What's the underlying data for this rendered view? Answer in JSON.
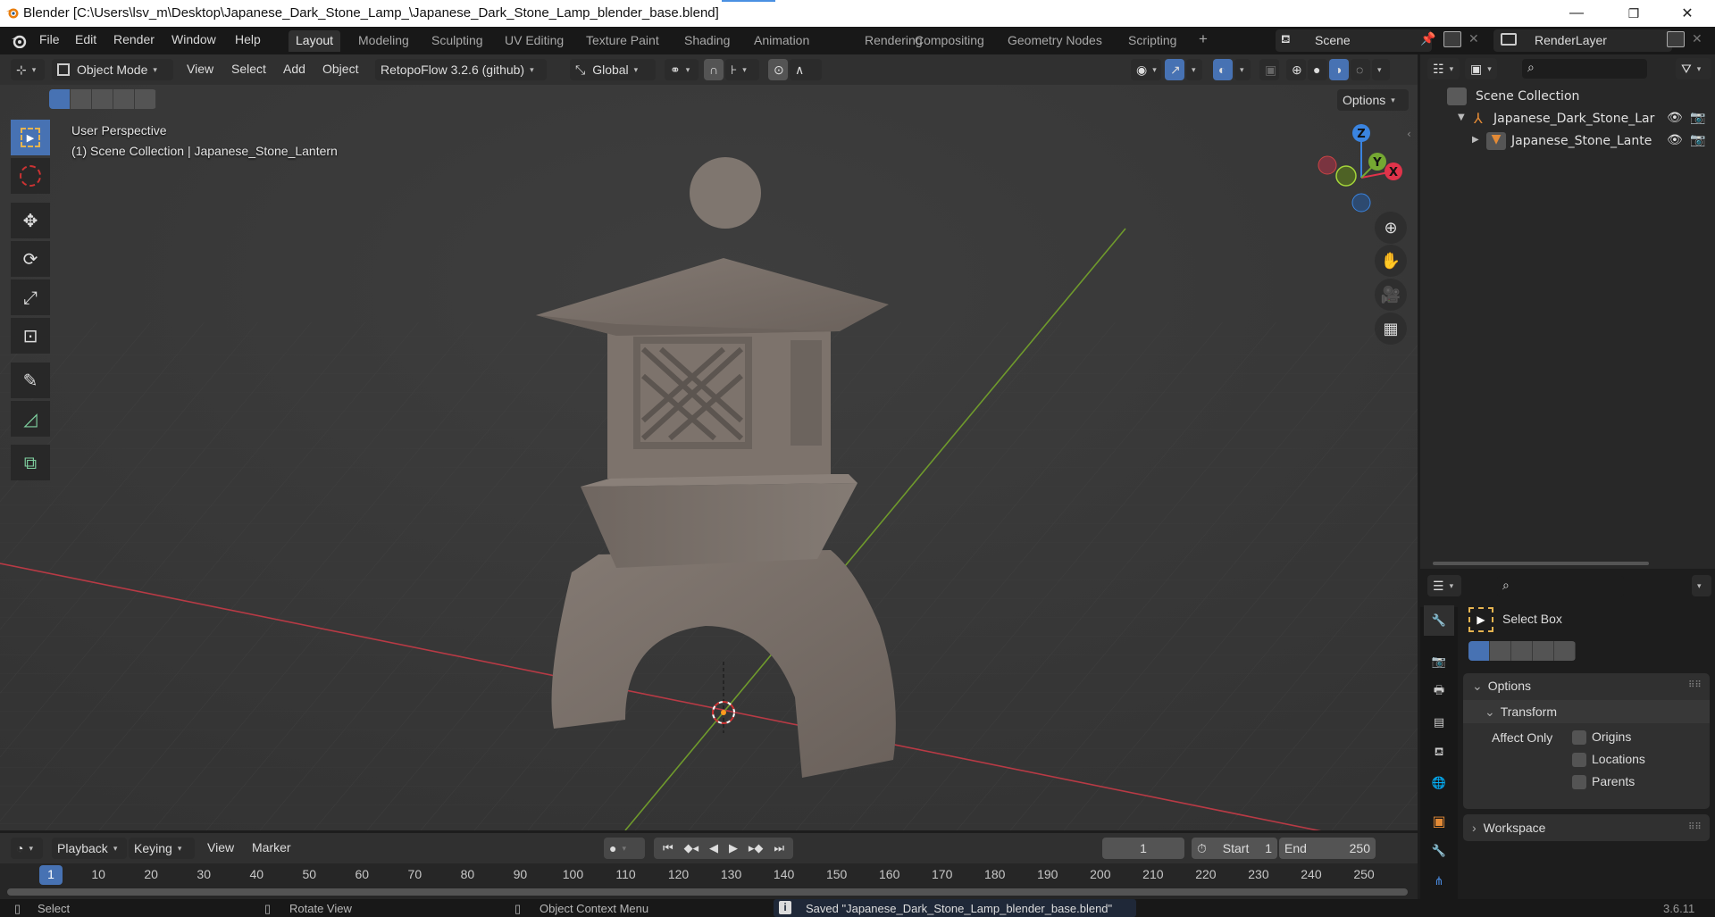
{
  "window": {
    "title": "Blender [C:\\Users\\lsv_m\\Desktop\\Japanese_Dark_Stone_Lamp_\\Japanese_Dark_Stone_Lamp_blender_base.blend]",
    "controls": {
      "minimize": "—",
      "maximize": "❐",
      "close": "✕"
    }
  },
  "menu": [
    "File",
    "Edit",
    "Render",
    "Window",
    "Help"
  ],
  "workspaces": [
    "Layout",
    "Modeling",
    "Sculpting",
    "UV Editing",
    "Texture Paint",
    "Shading",
    "Animation",
    "Rendering",
    "Compositing",
    "Geometry Nodes",
    "Scripting"
  ],
  "active_workspace": "Layout",
  "add_workspace": "+",
  "scene": {
    "name": "Scene",
    "view_layer": "RenderLayer"
  },
  "viewport_header": {
    "mode": "Object Mode",
    "menus": [
      "View",
      "Select",
      "Add",
      "Object"
    ],
    "addon": "RetopoFlow 3.2.6 (github)",
    "transform_orientation": "Global",
    "options": "Options"
  },
  "viewport": {
    "perspective": "User Perspective",
    "collection_info": "(1) Scene Collection | Japanese_Stone_Lantern",
    "gizmo_axes": {
      "z": "Z",
      "y": "Y",
      "x": "X"
    },
    "colors": {
      "x_axis": "#e0334a",
      "y_axis": "#75a832",
      "z_axis": "#3a84e0",
      "stone": "#7a706a",
      "grid_bg": "#3a3a3a"
    }
  },
  "tools": [
    "select-box",
    "cursor",
    "move",
    "rotate",
    "scale",
    "transform",
    "annotate",
    "measure",
    "add-cube"
  ],
  "outliner": {
    "root": "Scene Collection",
    "items": [
      {
        "name": "Japanese_Dark_Stone_Lar",
        "type": "empty",
        "expanded": true
      },
      {
        "name": "Japanese_Stone_Lantе",
        "type": "mesh",
        "expanded": false
      }
    ]
  },
  "properties": {
    "tool_name": "Select Box",
    "panels": {
      "options": "Options",
      "transform": "Transform",
      "affect_only": "Affect Only",
      "checkboxes": [
        {
          "label": "Origins",
          "checked": false
        },
        {
          "label": "Locations",
          "checked": false
        },
        {
          "label": "Parents",
          "checked": false
        }
      ],
      "workspace": "Workspace"
    }
  },
  "timeline": {
    "menus": [
      "Playback",
      "Keying",
      "View",
      "Marker"
    ],
    "current_frame": "1",
    "start_label": "Start",
    "start": "1",
    "end_label": "End",
    "end": "250",
    "ticks": [
      "10",
      "20",
      "30",
      "40",
      "50",
      "60",
      "70",
      "80",
      "90",
      "100",
      "110",
      "120",
      "130",
      "140",
      "150",
      "160",
      "170",
      "180",
      "190",
      "200",
      "210",
      "220",
      "230",
      "240",
      "250"
    ],
    "playhead": "1"
  },
  "statusbar": {
    "select": "Select",
    "rotate": "Rotate View",
    "context": "Object Context Menu",
    "message": "Saved \"Japanese_Dark_Stone_Lamp_blender_base.blend\"",
    "version": "3.6.11"
  }
}
